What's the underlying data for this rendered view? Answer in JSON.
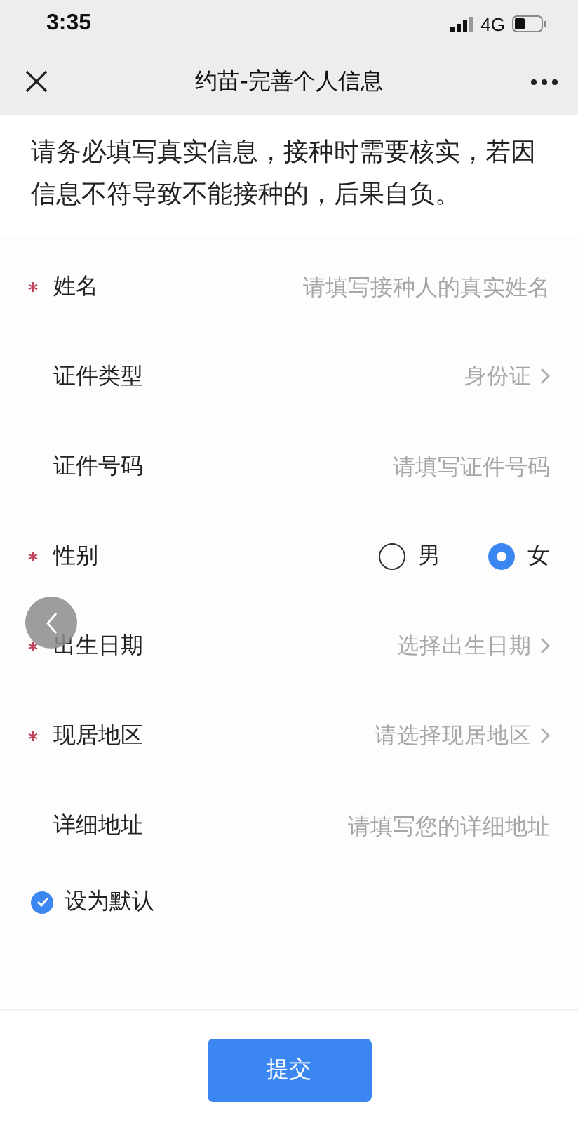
{
  "status_bar": {
    "time": "3:35",
    "network": "4G"
  },
  "nav": {
    "title": "约苗-完善个人信息"
  },
  "notice": "请务必填写真实信息，接种时需要核实，若因信息不符导致不能接种的，后果自负。",
  "fields": [
    {
      "kind": "input",
      "label": "姓名",
      "required": true,
      "placeholder": "请填写接种人的真实姓名"
    },
    {
      "kind": "select",
      "label": "证件类型",
      "required": false,
      "value": "身份证"
    },
    {
      "kind": "input",
      "label": "证件号码",
      "required": false,
      "placeholder": "请填写证件号码"
    },
    {
      "kind": "radio",
      "label": "性别",
      "required": true,
      "options": [
        {
          "label": "男",
          "selected": false
        },
        {
          "label": "女",
          "selected": true
        }
      ]
    },
    {
      "kind": "select",
      "label": "出生日期",
      "required": true,
      "placeholder": "选择出生日期"
    },
    {
      "kind": "select",
      "label": "现居地区",
      "required": true,
      "placeholder": "请选择现居地区"
    },
    {
      "kind": "input",
      "label": "详细地址",
      "required": false,
      "placeholder": "请填写您的详细地址"
    }
  ],
  "default_checkbox": {
    "label": "设为默认",
    "checked": true
  },
  "submit": "提交"
}
